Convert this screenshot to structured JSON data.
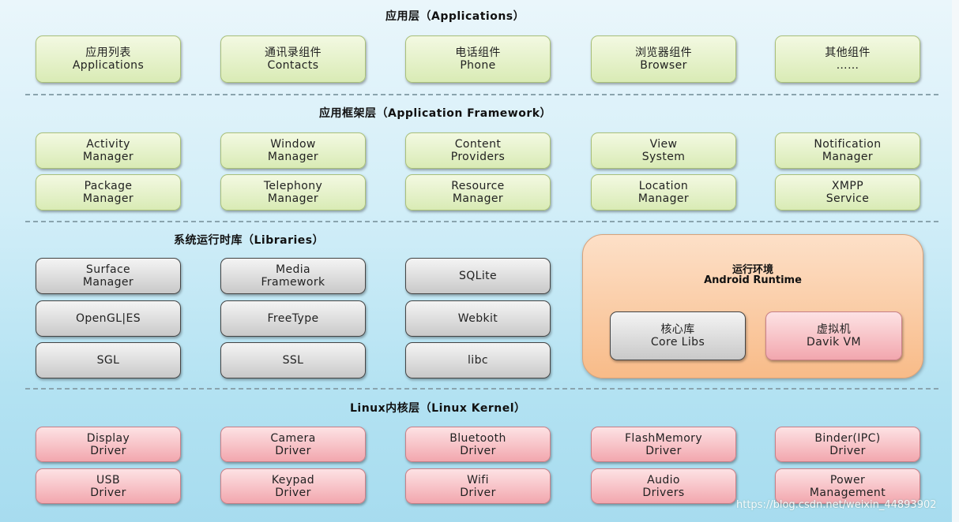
{
  "layers": {
    "applications": {
      "title": "应用层（Applications）",
      "items": [
        {
          "cn": "应用列表",
          "en": "Applications"
        },
        {
          "cn": "通讯录组件",
          "en": "Contacts"
        },
        {
          "cn": "电话组件",
          "en": "Phone"
        },
        {
          "cn": "浏览器组件",
          "en": "Browser"
        },
        {
          "cn": "其他组件",
          "en": "……"
        }
      ]
    },
    "framework": {
      "title": "应用框架层（Application Framework）",
      "items": [
        [
          "Activity",
          "Manager"
        ],
        [
          "Window",
          "Manager"
        ],
        [
          "Content",
          "Providers"
        ],
        [
          "View",
          "System"
        ],
        [
          "Notification",
          "Manager"
        ],
        [
          "Package",
          "Manager"
        ],
        [
          "Telephony",
          "Manager"
        ],
        [
          "Resource",
          "Manager"
        ],
        [
          "Location",
          "Manager"
        ],
        [
          "XMPP",
          "Service"
        ]
      ]
    },
    "libraries": {
      "title": "系统运行时库（Libraries）",
      "items": [
        [
          "Surface",
          "Manager"
        ],
        [
          "Media",
          "Framework"
        ],
        [
          "SQLite",
          ""
        ],
        [
          "OpenGL|ES",
          ""
        ],
        [
          "FreeType",
          ""
        ],
        [
          "Webkit",
          ""
        ],
        [
          "SGL",
          ""
        ],
        [
          "SSL",
          ""
        ],
        [
          "libc",
          ""
        ]
      ]
    },
    "runtime": {
      "title_cn": "运行环境",
      "title_en": "Android Runtime",
      "core": {
        "cn": "核心库",
        "en": "Core Libs"
      },
      "vm": {
        "cn": "虚拟机",
        "en": "Davik VM"
      }
    },
    "kernel": {
      "title": "Linux内核层（Linux Kernel）",
      "items": [
        [
          "Display",
          "Driver"
        ],
        [
          "Camera",
          "Driver"
        ],
        [
          "Bluetooth",
          "Driver"
        ],
        [
          "FlashMemory",
          "Driver"
        ],
        [
          "Binder(IPC)",
          "Driver"
        ],
        [
          "USB",
          "Driver"
        ],
        [
          "Keypad",
          "Driver"
        ],
        [
          "Wifi",
          "Driver"
        ],
        [
          "Audio",
          "Drivers"
        ],
        [
          "Power",
          "Management"
        ]
      ]
    }
  },
  "watermark": "https://blog.csdn.net/weixin_44893902",
  "colors": {
    "app": "#d9ebb5",
    "library": "#c9c9c9",
    "kernel": "#f2a7ae",
    "runtime": "#f8bb88",
    "background": "#b3e2f2"
  }
}
